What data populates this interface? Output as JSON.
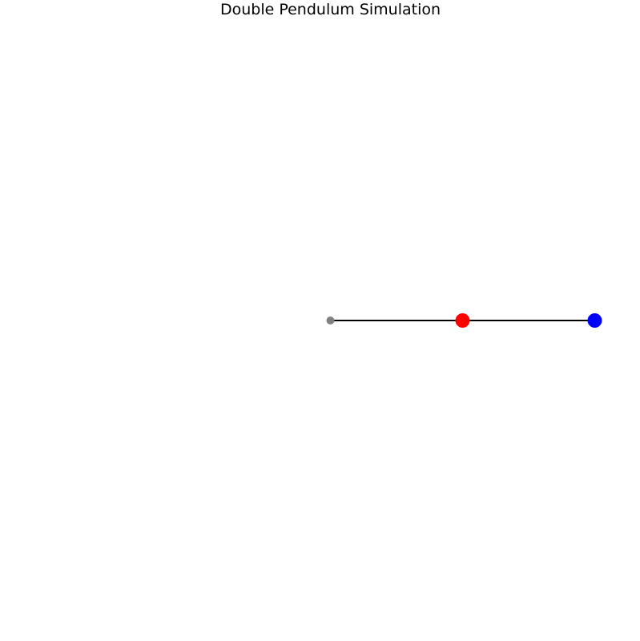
{
  "chart_data": {
    "type": "line",
    "title": "Double Pendulum Simulation",
    "xlabel": "",
    "ylabel": "",
    "xlim": [
      -2.5,
      2.5
    ],
    "ylim": [
      -2.5,
      2.5
    ],
    "grid": false,
    "axes_visible": false,
    "series": [
      {
        "x": [
          0,
          1,
          2
        ],
        "y": [
          0,
          0,
          0
        ],
        "color": "#000000"
      }
    ],
    "points": [
      {
        "x": 0,
        "y": 0,
        "color": "#808080"
      },
      {
        "x": 1,
        "y": 0,
        "color": "#ff0000"
      },
      {
        "x": 2,
        "y": 0,
        "color": "#0000ff"
      }
    ]
  }
}
